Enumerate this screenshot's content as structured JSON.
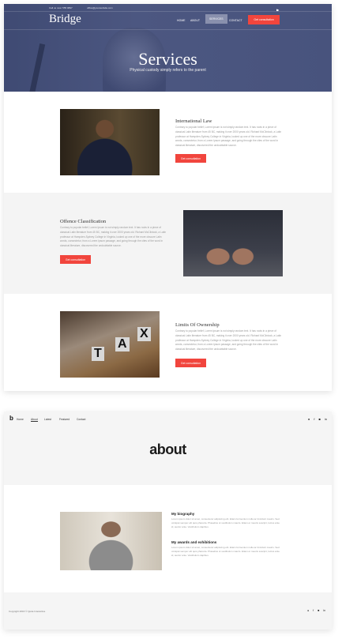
{
  "bridge": {
    "topbar": {
      "phone": "Call us now: 555 9897",
      "email": "office@yourwebsite.com",
      "social_icons": [
        "twitter-icon",
        "twitter-icon",
        "instagram-icon",
        "dribbble-icon",
        "facebook-icon",
        "linkedin-icon"
      ]
    },
    "logo": "Bridge",
    "nav": [
      "HOME",
      "ABOUT",
      "SERVICES",
      "CONTACT"
    ],
    "active_nav": "SERVICES",
    "cta": "Get consultation",
    "hero": {
      "title": "Services",
      "subtitle": "Physical custody simply refers to the parent"
    },
    "services": [
      {
        "title": "International Law",
        "text": "Contrary to popular belief, Lorem Ipsum is not simply random text. It has roots in a piece of classical Latin literature from 45 BC, making it over 2000 years old. Richard McClintock, a Latin professor at Hampden-Sydney College in Virginia, looked up one of the more obscure Latin words, consectetur, from a Lorem Ipsum passage, and going through the cites of the word in classical literature, discovered the undoubtable source.",
        "button": "Get consultation"
      },
      {
        "title": "Offence Classification",
        "text": "Contrary to popular belief, Lorem Ipsum is not simply random text. It has roots in a piece of classical Latin literature from 45 BC, making it over 2000 years old. Richard McClintock, a Latin professor at Hampden-Sydney College in Virginia, looked up one of the more obscure Latin words, consectetur, from a Lorem Ipsum passage, and going through the cites of the word in classical literature, discovered the undoubtable source.",
        "button": "Get consultation"
      },
      {
        "title": "Limits Of Ownership",
        "text": "Contrary to popular belief, Lorem Ipsum is not simply random text. It has roots in a piece of classical Latin literature from 45 BC, making it over 2000 years old. Richard McClintock, a Latin professor at Hampden-Sydney College in Virginia, looked up one of the more obscure Latin words, consectetur, from a Lorem Ipsum passage, and going through the cites of the word in classical literature, discovered the undoubtable source.",
        "button": "Get consultation"
      }
    ],
    "tax_letters": [
      "T",
      "A",
      "X"
    ]
  },
  "about": {
    "logo": "b",
    "nav": [
      "Home",
      "About",
      "Latest",
      "Featured",
      "Contact"
    ],
    "active_nav": "About",
    "title": "about",
    "blocks": [
      {
        "title": "My biography",
        "text": "Lorem ipsum dolor sit amet, consectetur adipiscing elit. Etiam fermentum nulla ac tincidunt mauris. Sed volutpat semper elit quis pharetra. Phasellus ut vestibulum mauris. Etiam et mauris suscipit, luctus ante id, auctor ante. Vestibulum dapibus."
      },
      {
        "title": "My awards and exhibitions",
        "text": "Lorem ipsum dolor sit amet, consectetur adipiscing elit. Etiam fermentum nulla ac tincidunt mauris. Sed volutpat semper elit quis pharetra. Phasellus ut vestibulum mauris. Etiam et mauris suscipit, luctus ante id, auctor ante. Vestibulum dapibus."
      }
    ],
    "copyright": "Copyright 2016 © Qode Interactive",
    "social_icons": [
      "twitter-icon",
      "facebook-icon",
      "instagram-icon",
      "linkedin-icon"
    ]
  }
}
